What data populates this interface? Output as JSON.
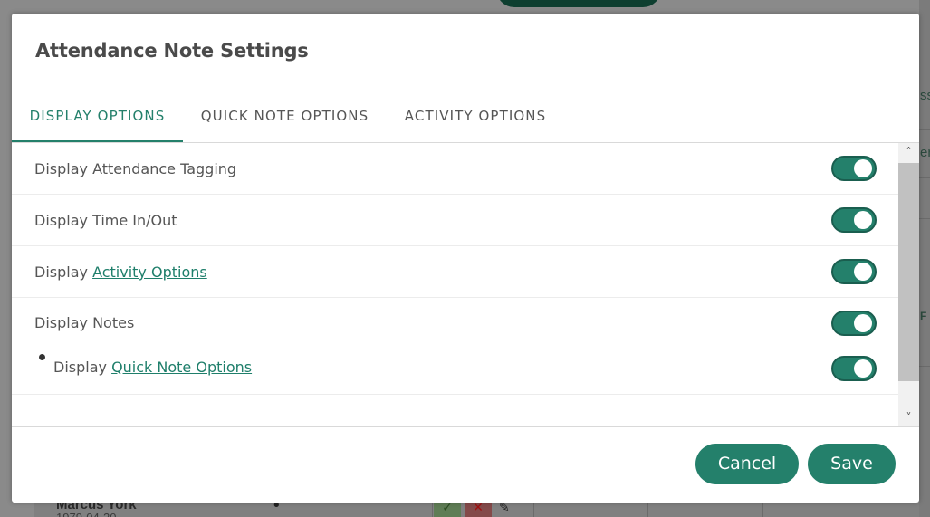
{
  "background": {
    "right_fragments": [
      "ss",
      "er",
      "F"
    ],
    "row_name": "Marcus York",
    "row_date": "1979-04-20"
  },
  "modal": {
    "title": "Attendance Note Settings",
    "tabs": [
      {
        "label": "DISPLAY OPTIONS",
        "active": true
      },
      {
        "label": "QUICK NOTE OPTIONS",
        "active": false
      },
      {
        "label": "ACTIVITY OPTIONS",
        "active": false
      }
    ],
    "settings": [
      {
        "prefix": "Display Attendance Tagging",
        "link": "",
        "enabled": true
      },
      {
        "prefix": "Display Time In/Out",
        "link": "",
        "enabled": true
      },
      {
        "prefix": "Display ",
        "link": "Activity Options",
        "enabled": true
      },
      {
        "prefix": "Display Notes",
        "link": "",
        "enabled": true
      },
      {
        "prefix": "Display ",
        "link": "Quick Note Options",
        "enabled": true,
        "sub": true
      }
    ],
    "buttons": {
      "cancel": "Cancel",
      "save": "Save"
    }
  },
  "colors": {
    "accent": "#24806b",
    "title": "#4a4a4a",
    "text": "#555555"
  },
  "icons": {
    "scroll_up": "chevron-up-icon",
    "scroll_down": "chevron-down-icon",
    "bullet": "bullet-icon"
  }
}
